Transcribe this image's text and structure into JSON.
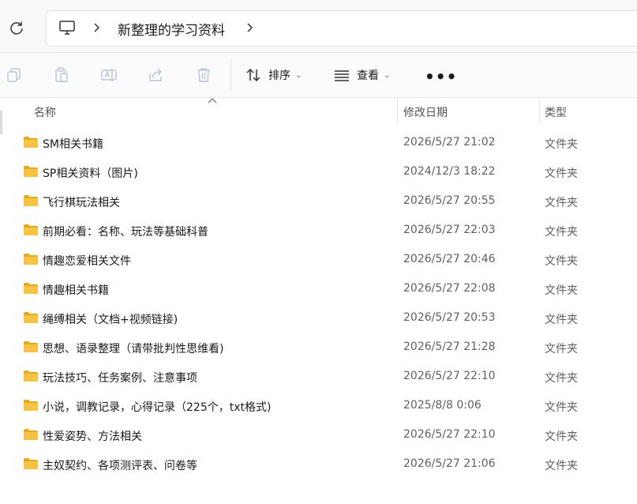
{
  "address": {
    "path": "新整理的学习资料"
  },
  "toolbar": {
    "sort_label": "排序",
    "view_label": "查看",
    "more_label": "•••"
  },
  "columns": {
    "name": "名称",
    "date": "修改日期",
    "type": "类型"
  },
  "colors": {
    "folder": "#f6c343",
    "folder_dark": "#e8a917"
  },
  "files": [
    {
      "name": "SM相关书籍",
      "date": "2026/5/27 21:02",
      "type": "文件夹"
    },
    {
      "name": "SP相关资料（图片)",
      "date": "2024/12/3 18:22",
      "type": "文件夹"
    },
    {
      "name": "飞行棋玩法相关",
      "date": "2026/5/27 20:55",
      "type": "文件夹"
    },
    {
      "name": "前期必看：名称、玩法等基础科普",
      "date": "2026/5/27 22:03",
      "type": "文件夹"
    },
    {
      "name": "情趣恋爱相关文件",
      "date": "2026/5/27 20:46",
      "type": "文件夹"
    },
    {
      "name": "情趣相关书籍",
      "date": "2026/5/27 22:08",
      "type": "文件夹"
    },
    {
      "name": "绳缚相关（文档+视频链接)",
      "date": "2026/5/27 20:53",
      "type": "文件夹"
    },
    {
      "name": "思想、语录整理（请带批判性思维看)",
      "date": "2026/5/27 21:28",
      "type": "文件夹"
    },
    {
      "name": "玩法技巧、任务案例、注意事项",
      "date": "2026/5/27 22:10",
      "type": "文件夹"
    },
    {
      "name": "小说，调教记录，心得记录（225个，txt格式)",
      "date": "2025/8/8 0:06",
      "type": "文件夹"
    },
    {
      "name": "性爱姿势、方法相关",
      "date": "2026/5/27 22:10",
      "type": "文件夹"
    },
    {
      "name": "主奴契约、各项测评表、问卷等",
      "date": "2026/5/27 21:06",
      "type": "文件夹"
    }
  ]
}
